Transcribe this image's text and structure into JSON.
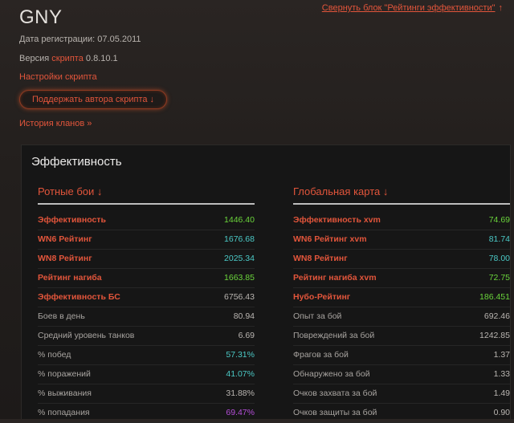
{
  "header": {
    "username": "GNY",
    "collapse_link": "Свернуть блок \"Рейтинги эффективности\"",
    "collapse_arrow": "↑",
    "registration": "Дата регистрации: 07.05.2011",
    "version_prefix": "Версия",
    "version_link": "скрипта",
    "version_number": "0.8.10.1",
    "settings_link": "Настройки скрипта",
    "support_button": "Поддержать автора скрипта ↓",
    "clan_history_link": "История кланов »"
  },
  "panel": {
    "title": "Эффективность",
    "left": {
      "heading": "Ротные бои ↓",
      "rows": [
        {
          "label": "Эффективность",
          "value": "1446.40",
          "highlight": true,
          "color": "#6ad43b"
        },
        {
          "label": "WN6 Рейтинг",
          "value": "1676.68",
          "highlight": true,
          "color": "#4bc9c6"
        },
        {
          "label": "WN8 Рейтинг",
          "value": "2025.34",
          "highlight": true,
          "color": "#4bc9c6"
        },
        {
          "label": "Рейтинг нагиба",
          "value": "1663.85",
          "highlight": true,
          "color": "#6ad43b"
        },
        {
          "label": "Эффективность БС",
          "value": "6756.43",
          "highlight": true,
          "color": "#b9b5b1"
        },
        {
          "label": "Боев в день",
          "value": "80.94",
          "highlight": false,
          "color": "#b9b5b1"
        },
        {
          "label": "Средний уровень танков",
          "value": "6.69",
          "highlight": false,
          "color": "#b9b5b1"
        },
        {
          "label": "% побед",
          "value": "57.31%",
          "highlight": false,
          "color": "#4bc9c6"
        },
        {
          "label": "% поражений",
          "value": "41.07%",
          "highlight": false,
          "color": "#4bc9c6"
        },
        {
          "label": "% выживания",
          "value": "31.88%",
          "highlight": false,
          "color": "#b9b5b1"
        },
        {
          "label": "% попадания",
          "value": "69.47%",
          "highlight": false,
          "color": "#b44ed8"
        }
      ]
    },
    "right": {
      "heading": "Глобальная карта ↓",
      "rows": [
        {
          "label": "Эффективность xvm",
          "value": "74.69",
          "highlight": true,
          "color": "#6ad43b"
        },
        {
          "label": "WN6 Рейтинг xvm",
          "value": "81.74",
          "highlight": true,
          "color": "#4bc9c6"
        },
        {
          "label": "WN8 Рейтинг",
          "value": "78.00",
          "highlight": true,
          "color": "#4bc9c6"
        },
        {
          "label": "Рейтинг нагиба xvm",
          "value": "72.75",
          "highlight": true,
          "color": "#6ad43b"
        },
        {
          "label": "Нубо-Рейтинг",
          "value": "186.451",
          "highlight": true,
          "color": "#6ad43b"
        },
        {
          "label": "Опыт за бой",
          "value": "692.46",
          "highlight": false,
          "color": "#b9b5b1"
        },
        {
          "label": "Повреждений за бой",
          "value": "1242.85",
          "highlight": false,
          "color": "#b9b5b1"
        },
        {
          "label": "Фрагов за бой",
          "value": "1.37",
          "highlight": false,
          "color": "#b9b5b1"
        },
        {
          "label": "Обнаружено за бой",
          "value": "1.33",
          "highlight": false,
          "color": "#b9b5b1"
        },
        {
          "label": "Очков захвата за бой",
          "value": "1.49",
          "highlight": false,
          "color": "#b9b5b1"
        },
        {
          "label": "Очков защиты за бой",
          "value": "0.90",
          "highlight": false,
          "color": "#b9b5b1"
        }
      ]
    }
  },
  "colors": {
    "accent": "#e2553b",
    "green": "#6ad43b",
    "teal": "#4bc9c6",
    "purple": "#b44ed8",
    "panel_bg": "#161616",
    "page_bg": "#2a2523"
  }
}
